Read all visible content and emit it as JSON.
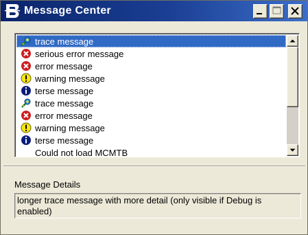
{
  "window": {
    "title": "Message Center"
  },
  "title_buttons": [
    "minimize",
    "maximize",
    "close"
  ],
  "messages": [
    {
      "icon": "trace-icon",
      "text": "trace message",
      "selected": true
    },
    {
      "icon": "error-icon",
      "text": "serious error message",
      "selected": false
    },
    {
      "icon": "error-icon",
      "text": "error message",
      "selected": false
    },
    {
      "icon": "warning-icon",
      "text": "warning message",
      "selected": false
    },
    {
      "icon": "info-icon",
      "text": "terse message",
      "selected": false
    },
    {
      "icon": "trace-icon",
      "text": "trace message",
      "selected": false
    },
    {
      "icon": "error-icon",
      "text": "error message",
      "selected": false
    },
    {
      "icon": "warning-icon",
      "text": "warning message",
      "selected": false
    },
    {
      "icon": "info-icon",
      "text": "terse message",
      "selected": false
    },
    {
      "icon": "none",
      "text": "Could not load MCMTB",
      "selected": false
    }
  ],
  "details": {
    "label": "Message Details",
    "text": "longer trace message with more detail (only visible if Debug is enabled)"
  },
  "colors": {
    "titlebar": "#0A246A",
    "selection": "#316AC5",
    "error": "#CC1E1E",
    "warning": "#F6E512",
    "info": "#0A1E7A"
  }
}
